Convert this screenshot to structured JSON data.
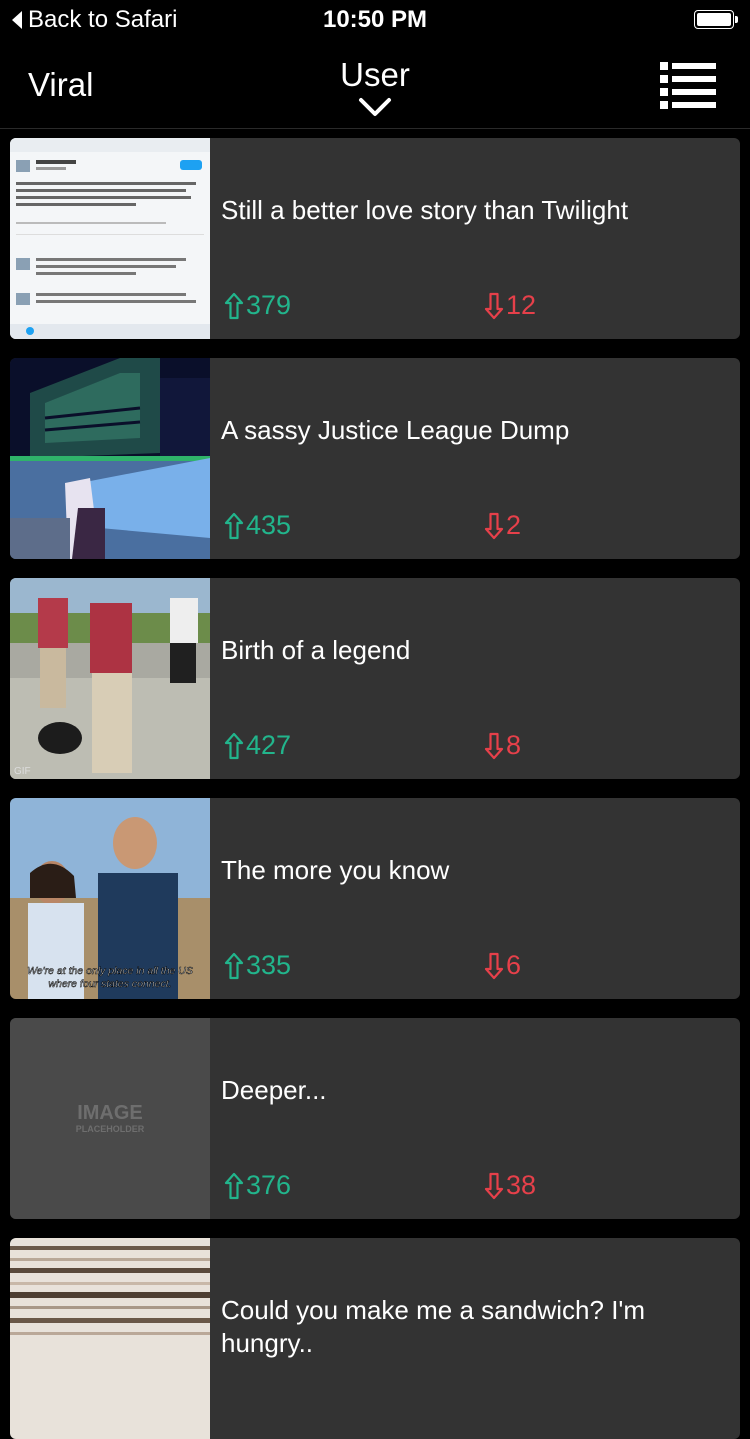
{
  "status_bar": {
    "back_label": "Back to Safari",
    "time": "10:50 PM"
  },
  "nav": {
    "left_label": "Viral",
    "title": "User"
  },
  "posts": [
    {
      "title": "Still a better love story than Twilight",
      "upvotes": "379",
      "downvotes": "12"
    },
    {
      "title": "A sassy Justice League Dump",
      "upvotes": "435",
      "downvotes": "2"
    },
    {
      "title": "Birth of a legend",
      "upvotes": "427",
      "downvotes": "8"
    },
    {
      "title": "The more you know",
      "upvotes": "335",
      "downvotes": "6",
      "thumb_caption_1": "We're at the only place in all the US",
      "thumb_caption_2": "where four states connect."
    },
    {
      "title": "Deeper...",
      "upvotes": "376",
      "downvotes": "38",
      "placeholder_1": "IMAGE",
      "placeholder_2": "PLACEHOLDER"
    },
    {
      "title": "Could you make me a sandwich? I'm hungry..",
      "upvotes": "",
      "downvotes": ""
    }
  ],
  "colors": {
    "upvote": "#22b58c",
    "downvote": "#e6404a",
    "card": "#333333"
  }
}
